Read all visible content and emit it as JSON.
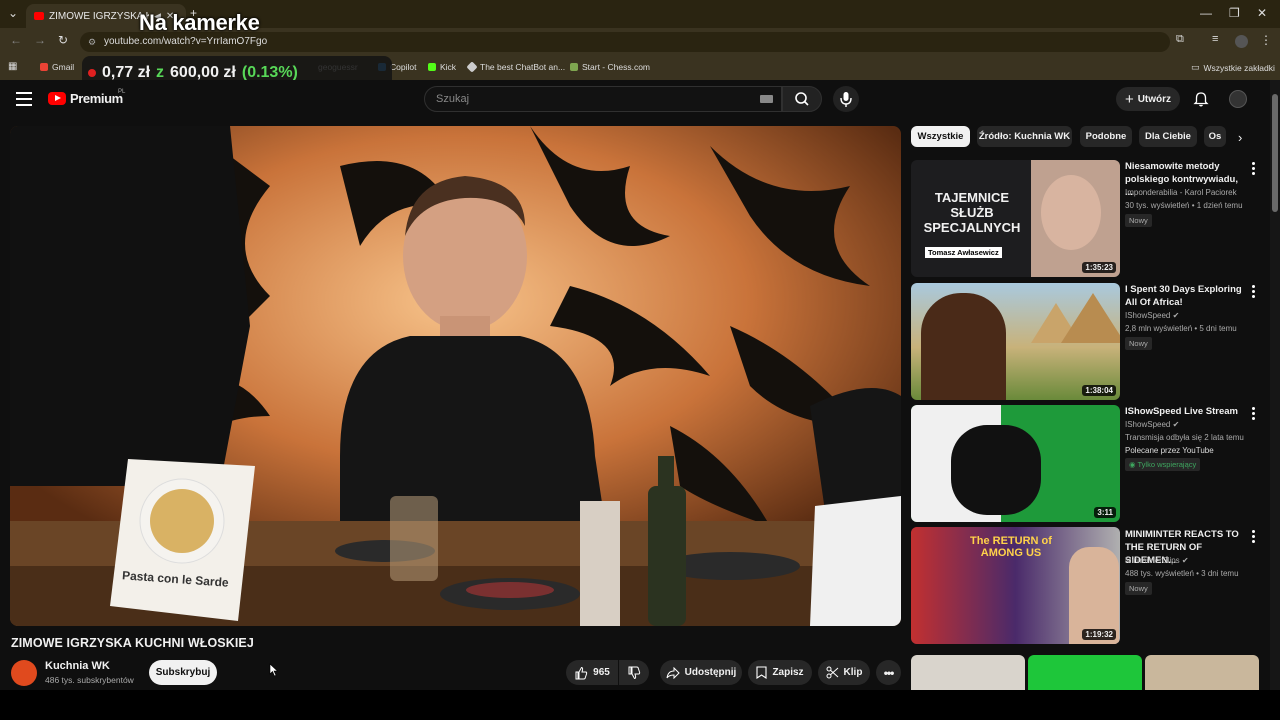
{
  "browser": {
    "tab_title": "ZIMOWE IGRZYSKA KUCHN",
    "url": "youtube.com/watch?v=YrrIamO7Fgo",
    "bookmarks": [
      {
        "label": "Gmail",
        "color": "#ea4335"
      },
      {
        "label": "geoguessr",
        "color": "#888888"
      },
      {
        "label": "Copilot",
        "color": "#3aa0ff"
      },
      {
        "label": "Kick",
        "color": "#53fc18"
      },
      {
        "label": "The best ChatBot an...",
        "color": "#cccccc"
      },
      {
        "label": "Start - Chess.com",
        "color": "#7fa650"
      }
    ],
    "all_bookmarks": "Wszystkie zakładki"
  },
  "overlay": {
    "camera_label": "Na kamerke",
    "ticker_from": "0,77 zł",
    "ticker_z": "z",
    "ticker_to": "600,00 zł",
    "ticker_pct": "(0.13%)"
  },
  "header": {
    "logo_text": "Premium",
    "logo_country": "PL",
    "search_placeholder": "Szukaj",
    "create_label": "Utwórz"
  },
  "video": {
    "title": "ZIMOWE IGRZYSKA KUCHNI WŁOSKIEJ",
    "sign_text": "Pasta con le Sarde",
    "channel_name": "Kuchnia WK",
    "channel_subs": "486 tys. subskrybentów",
    "subscribe_label": "Subskrybuj",
    "likes": "965",
    "share_label": "Udostępnij",
    "save_label": "Zapisz",
    "clip_label": "Klip"
  },
  "chips": [
    "Wszystkie",
    "Źródło: Kuchnia WK",
    "Podobne",
    "Dla Ciebie",
    "Os"
  ],
  "recommendations": [
    {
      "title": "Niesamowite metody polskiego kontrwywiadu, ...",
      "channel": "Imponderabilia - Karol Paciorek",
      "meta": "30 tys. wyświetleń • 1 dzień temu",
      "badge": "Nowy",
      "duration": "1:35:23",
      "thumb_text": "TAJEMNICE SŁUŻB SPECJALNYCH",
      "thumb_sub": "Tomasz Awłasewicz"
    },
    {
      "title": "I Spent 30 Days Exploring All Of Africa!",
      "channel": "IShowSpeed",
      "meta": "2,8 mln wyświetleń • 5 dni temu",
      "badge": "Nowy",
      "duration": "1:38:04"
    },
    {
      "title": "IShowSpeed Live Stream",
      "channel": "IShowSpeed",
      "meta": "Transmisja odbyła się 2 lata temu",
      "extra": "Polecane przez YouTube",
      "members": "Tylko wspierający",
      "duration": "3:11"
    },
    {
      "title": "MINIMINTER REACTS TO THE RETURN OF SIDEMEN...",
      "channel": "MiniminterClips",
      "meta": "488 tys. wyświetleń • 3 dni temu",
      "badge": "Nowy",
      "duration": "1:19:32",
      "thumb_text": "The RETURN of AMONG US"
    }
  ]
}
